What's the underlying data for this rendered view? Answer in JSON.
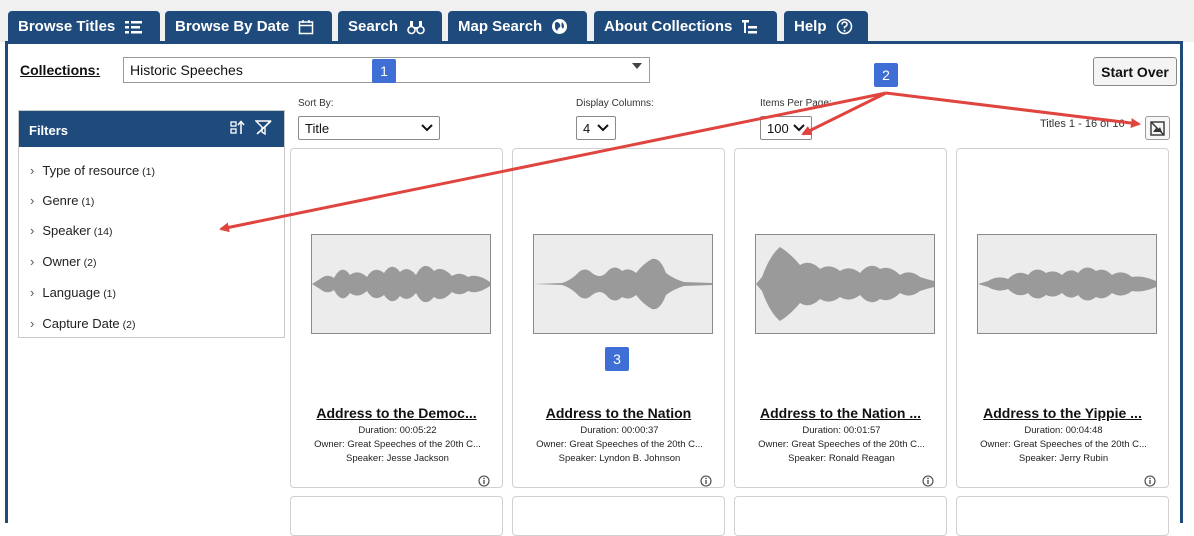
{
  "tabs": [
    {
      "label": "Browse Titles",
      "icon": "list-icon"
    },
    {
      "label": "Browse By Date",
      "icon": "calendar-icon"
    },
    {
      "label": "Search",
      "icon": "binoculars-icon"
    },
    {
      "label": "Map Search",
      "icon": "globe-icon"
    },
    {
      "label": "About Collections",
      "icon": "tree-icon"
    },
    {
      "label": "Help",
      "icon": "help-icon"
    }
  ],
  "collections": {
    "label": "Collections:",
    "value": "Historic Speeches"
  },
  "start_over": "Start Over",
  "filters": {
    "title": "Filters",
    "facets": [
      {
        "name": "Type of resource",
        "count": "(1)"
      },
      {
        "name": "Genre",
        "count": "(1)"
      },
      {
        "name": "Speaker",
        "count": "(14)"
      },
      {
        "name": "Owner",
        "count": "(2)"
      },
      {
        "name": "Language",
        "count": "(1)"
      },
      {
        "name": "Capture Date",
        "count": "(2)"
      }
    ]
  },
  "controls": {
    "sort_label": "Sort By:",
    "sort_value": "Title",
    "columns_label": "Display Columns:",
    "columns_value": "4",
    "per_page_label": "Items Per Page:",
    "per_page_value": "100",
    "results": "Titles 1 - 16 of 16"
  },
  "annotations": [
    "1",
    "2",
    "3"
  ],
  "cards": [
    {
      "title": "Address to the Democ...",
      "duration": "Duration: 00:05:22",
      "owner": "Owner: Great Speeches of the 20th C...",
      "speaker": "Speaker: Jesse Jackson"
    },
    {
      "title": "Address to the Nation",
      "duration": "Duration: 00:00:37",
      "owner": "Owner: Great Speeches of the 20th C...",
      "speaker": "Speaker: Lyndon B. Johnson"
    },
    {
      "title": "Address to the Nation ...",
      "duration": "Duration: 00:01:57",
      "owner": "Owner: Great Speeches of the 20th C...",
      "speaker": "Speaker: Ronald Reagan"
    },
    {
      "title": "Address to the Yippie ...",
      "duration": "Duration: 00:04:48",
      "owner": "Owner: Great Speeches of the 20th C...",
      "speaker": "Speaker: Jerry Rubin"
    }
  ],
  "colors": {
    "brand": "#1f4b7c",
    "badge": "#3f6fd4",
    "arrow": "#e0443f"
  }
}
